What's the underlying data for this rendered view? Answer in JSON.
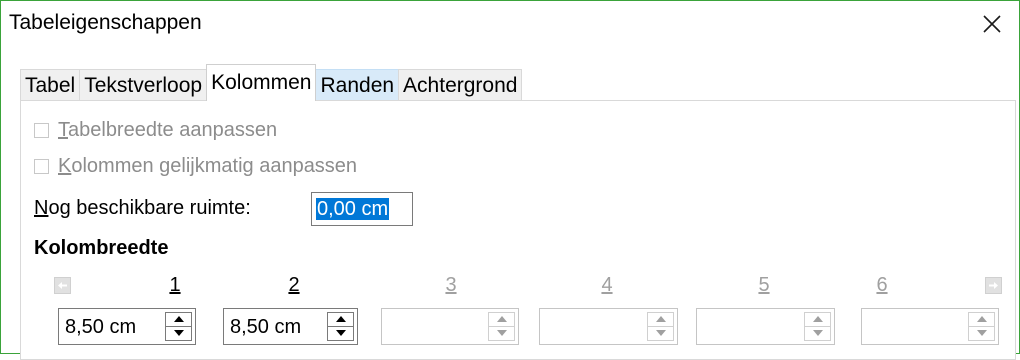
{
  "window": {
    "title": "Tabeleigenschappen",
    "close_icon": "close-x"
  },
  "tabs": [
    {
      "label": "Tabel"
    },
    {
      "label": "Tekstverloop"
    },
    {
      "label": "Kolommen",
      "active": true
    },
    {
      "label": "Randen",
      "hover": true
    },
    {
      "label": "Achtergrond"
    }
  ],
  "options": {
    "adapt_width": {
      "label_u": "T",
      "label_rest": "abelbreedte aanpassen",
      "checked": false,
      "enabled": false
    },
    "adapt_columns": {
      "label_u": "K",
      "label_rest": "olommen gelijkmatig aanpassen",
      "checked": false,
      "enabled": false
    }
  },
  "remaining_space": {
    "label_u": "N",
    "label_rest": "og beschikbare ruimte:",
    "value": "0,00 cm"
  },
  "column_width": {
    "title": "Kolombreedte",
    "left_arrow_icon": "arrow-left",
    "right_arrow_icon": "arrow-right",
    "columns": [
      {
        "number": "1",
        "value": "8,50 cm",
        "enabled": true
      },
      {
        "number": "2",
        "value": "8,50 cm",
        "enabled": true
      },
      {
        "number": "3",
        "value": "",
        "enabled": false
      },
      {
        "number": "4",
        "value": "",
        "enabled": false
      },
      {
        "number": "5",
        "value": "",
        "enabled": false
      },
      {
        "number": "6",
        "value": "",
        "enabled": false
      }
    ]
  },
  "colors": {
    "window_border": "#3aa33a",
    "selection": "#0078d7",
    "tab_hover": "#d8eaf9",
    "disabled_text": "#8c8c8c"
  }
}
